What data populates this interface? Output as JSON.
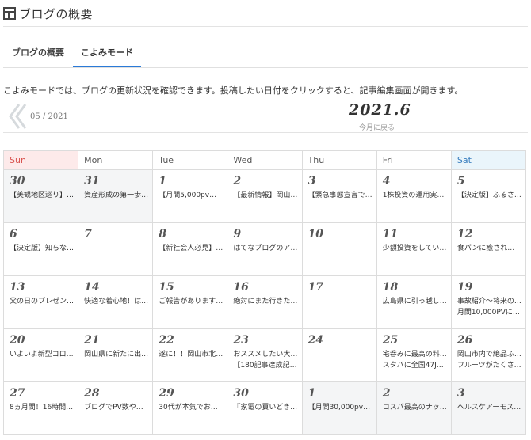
{
  "header": {
    "title": "ブログの概要",
    "icon": "layout-icon"
  },
  "tabs": [
    {
      "label": "ブログの概要",
      "active": false
    },
    {
      "label": "こよみモード",
      "active": true
    }
  ],
  "description": "こよみモードでは、ブログの更新状況を確認できます。投稿したい日付をクリックすると、記事編集画面が開きます。",
  "nav": {
    "prev_label": "05 / 2021",
    "current_month": "2021.6",
    "today_label": "今月に戻る"
  },
  "colors": {
    "tab_active": "#2a7ad8",
    "sun_header_bg": "#fdeaea",
    "sun_header_text": "#d9534f",
    "sat_header_bg": "#eaf5fb",
    "sat_header_text": "#3a7fbf"
  },
  "weekdays": [
    "Sun",
    "Mon",
    "Tue",
    "Wed",
    "Thu",
    "Fri",
    "Sat"
  ],
  "weeks": [
    [
      {
        "day": "30",
        "muted": true,
        "entries": [
          "【美観地区巡り】…"
        ]
      },
      {
        "day": "31",
        "muted": true,
        "entries": [
          "資産形成の第一歩…"
        ]
      },
      {
        "day": "1",
        "muted": false,
        "entries": [
          "【月間5,000pv達…"
        ]
      },
      {
        "day": "2",
        "muted": false,
        "entries": [
          "【最新情報】岡山…"
        ]
      },
      {
        "day": "3",
        "muted": false,
        "entries": [
          "【緊急事態宣言で…"
        ]
      },
      {
        "day": "4",
        "muted": false,
        "entries": [
          "1株投資の運用実…"
        ]
      },
      {
        "day": "5",
        "muted": false,
        "entries": [
          "【決定版】ふるさ…"
        ]
      }
    ],
    [
      {
        "day": "6",
        "muted": false,
        "entries": [
          "【決定版】知らな…"
        ]
      },
      {
        "day": "7",
        "muted": false,
        "entries": []
      },
      {
        "day": "8",
        "muted": false,
        "entries": [
          "【新社会人必見】…"
        ]
      },
      {
        "day": "9",
        "muted": false,
        "entries": [
          "はてなブログのア…"
        ]
      },
      {
        "day": "10",
        "muted": false,
        "entries": []
      },
      {
        "day": "11",
        "muted": false,
        "entries": [
          "少額投資をしてい…"
        ]
      },
      {
        "day": "12",
        "muted": false,
        "entries": [
          "食パンに癒される…"
        ]
      }
    ],
    [
      {
        "day": "13",
        "muted": false,
        "entries": [
          "父の日のプレゼン…"
        ]
      },
      {
        "day": "14",
        "muted": false,
        "entries": [
          "快適な着心地！は…"
        ]
      },
      {
        "day": "15",
        "muted": false,
        "entries": [
          "ご報告があります…"
        ]
      },
      {
        "day": "16",
        "muted": false,
        "entries": [
          "絶対にまた行きた…"
        ]
      },
      {
        "day": "17",
        "muted": false,
        "entries": []
      },
      {
        "day": "18",
        "muted": false,
        "entries": [
          "広島県に引っ越し…"
        ]
      },
      {
        "day": "19",
        "muted": false,
        "entries": [
          "事故紹介～将来の…",
          "月間10,000PVに…"
        ]
      }
    ],
    [
      {
        "day": "20",
        "muted": false,
        "entries": [
          "いよいよ新型コロ…"
        ]
      },
      {
        "day": "21",
        "muted": false,
        "entries": [
          "岡山県に新たに出…"
        ]
      },
      {
        "day": "22",
        "muted": false,
        "entries": [
          "遂に！！岡山市北…"
        ]
      },
      {
        "day": "23",
        "muted": false,
        "entries": [
          "おススメしたい大…",
          "【180記事達成記…"
        ]
      },
      {
        "day": "24",
        "muted": false,
        "entries": []
      },
      {
        "day": "25",
        "muted": false,
        "entries": [
          "宅呑みに最高の料…",
          "スタバに全国47J…"
        ]
      },
      {
        "day": "26",
        "muted": false,
        "entries": [
          "岡山市内で絶品ふ…",
          "フルーツがたくさ…"
        ]
      }
    ],
    [
      {
        "day": "27",
        "muted": false,
        "entries": [
          "8ヵ月間！16時間…"
        ]
      },
      {
        "day": "28",
        "muted": false,
        "entries": [
          "ブログでPV数や…"
        ]
      },
      {
        "day": "29",
        "muted": false,
        "entries": [
          "30代が本気でお金…"
        ]
      },
      {
        "day": "30",
        "muted": false,
        "entries": [
          "『家電の買いどき…"
        ]
      },
      {
        "day": "1",
        "muted": true,
        "entries": [
          "【月間30,000pv…"
        ]
      },
      {
        "day": "2",
        "muted": true,
        "entries": [
          "コスパ最高のナッ…"
        ]
      },
      {
        "day": "3",
        "muted": true,
        "entries": [
          "ヘルスケアーモス…"
        ]
      }
    ]
  ]
}
